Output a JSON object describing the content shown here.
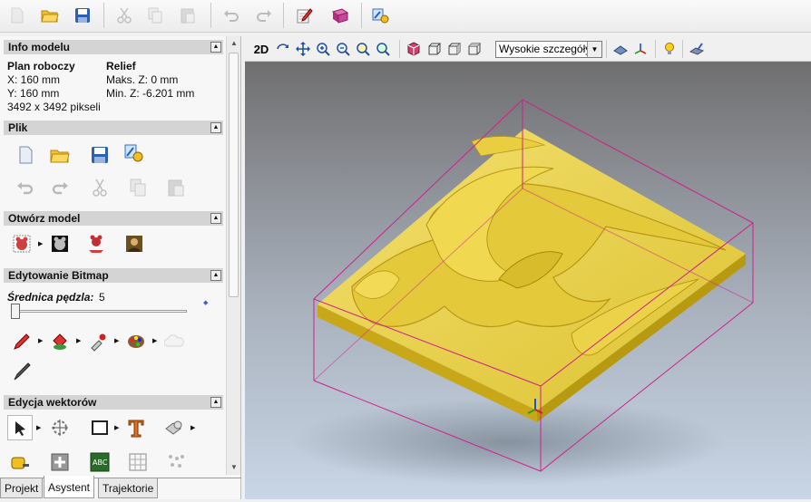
{
  "toolbar": {
    "buttons": [
      {
        "name": "new-file",
        "enabled": false
      },
      {
        "name": "open-folder",
        "enabled": true
      },
      {
        "name": "save",
        "enabled": true
      },
      {
        "name": "cut",
        "enabled": false
      },
      {
        "name": "copy",
        "enabled": false
      },
      {
        "name": "paste",
        "enabled": false
      },
      {
        "name": "undo",
        "enabled": false
      },
      {
        "name": "redo",
        "enabled": false
      },
      {
        "name": "notepad-edit",
        "enabled": true
      },
      {
        "name": "book-help",
        "enabled": true
      },
      {
        "name": "wizard-settings",
        "enabled": true
      }
    ]
  },
  "info": {
    "header": "Info modelu",
    "left_title": "Plan roboczy",
    "x": "X: 160 mm",
    "y": "Y: 160 mm",
    "pixels": "3492 x 3492 pikseli",
    "right_title": "Relief",
    "max_z": "Maks. Z: 0 mm",
    "min_z": "Min. Z: -6.201 mm"
  },
  "file_section": {
    "header": "Plik"
  },
  "open_model": {
    "header": "Otwórz model"
  },
  "bitmap": {
    "header": "Edytowanie Bitmap",
    "brush_label": "Średnica pędzla:",
    "brush_value": "5",
    "brush_level": 0.0
  },
  "vectors": {
    "header": "Edycja wektorów"
  },
  "tabs": [
    {
      "label": "Projekt",
      "active": false
    },
    {
      "label": "Asystent",
      "active": true
    },
    {
      "label": "Trajektorie",
      "active": false
    }
  ],
  "view": {
    "mode_label": "2D",
    "detail_select": "Wysokie szczegóły"
  },
  "colors": {
    "relief_gold": "#e8cf3c",
    "bounding_box": "#d0208c",
    "background_top": "#6f6f70",
    "background_bottom": "#c9d6e6"
  }
}
